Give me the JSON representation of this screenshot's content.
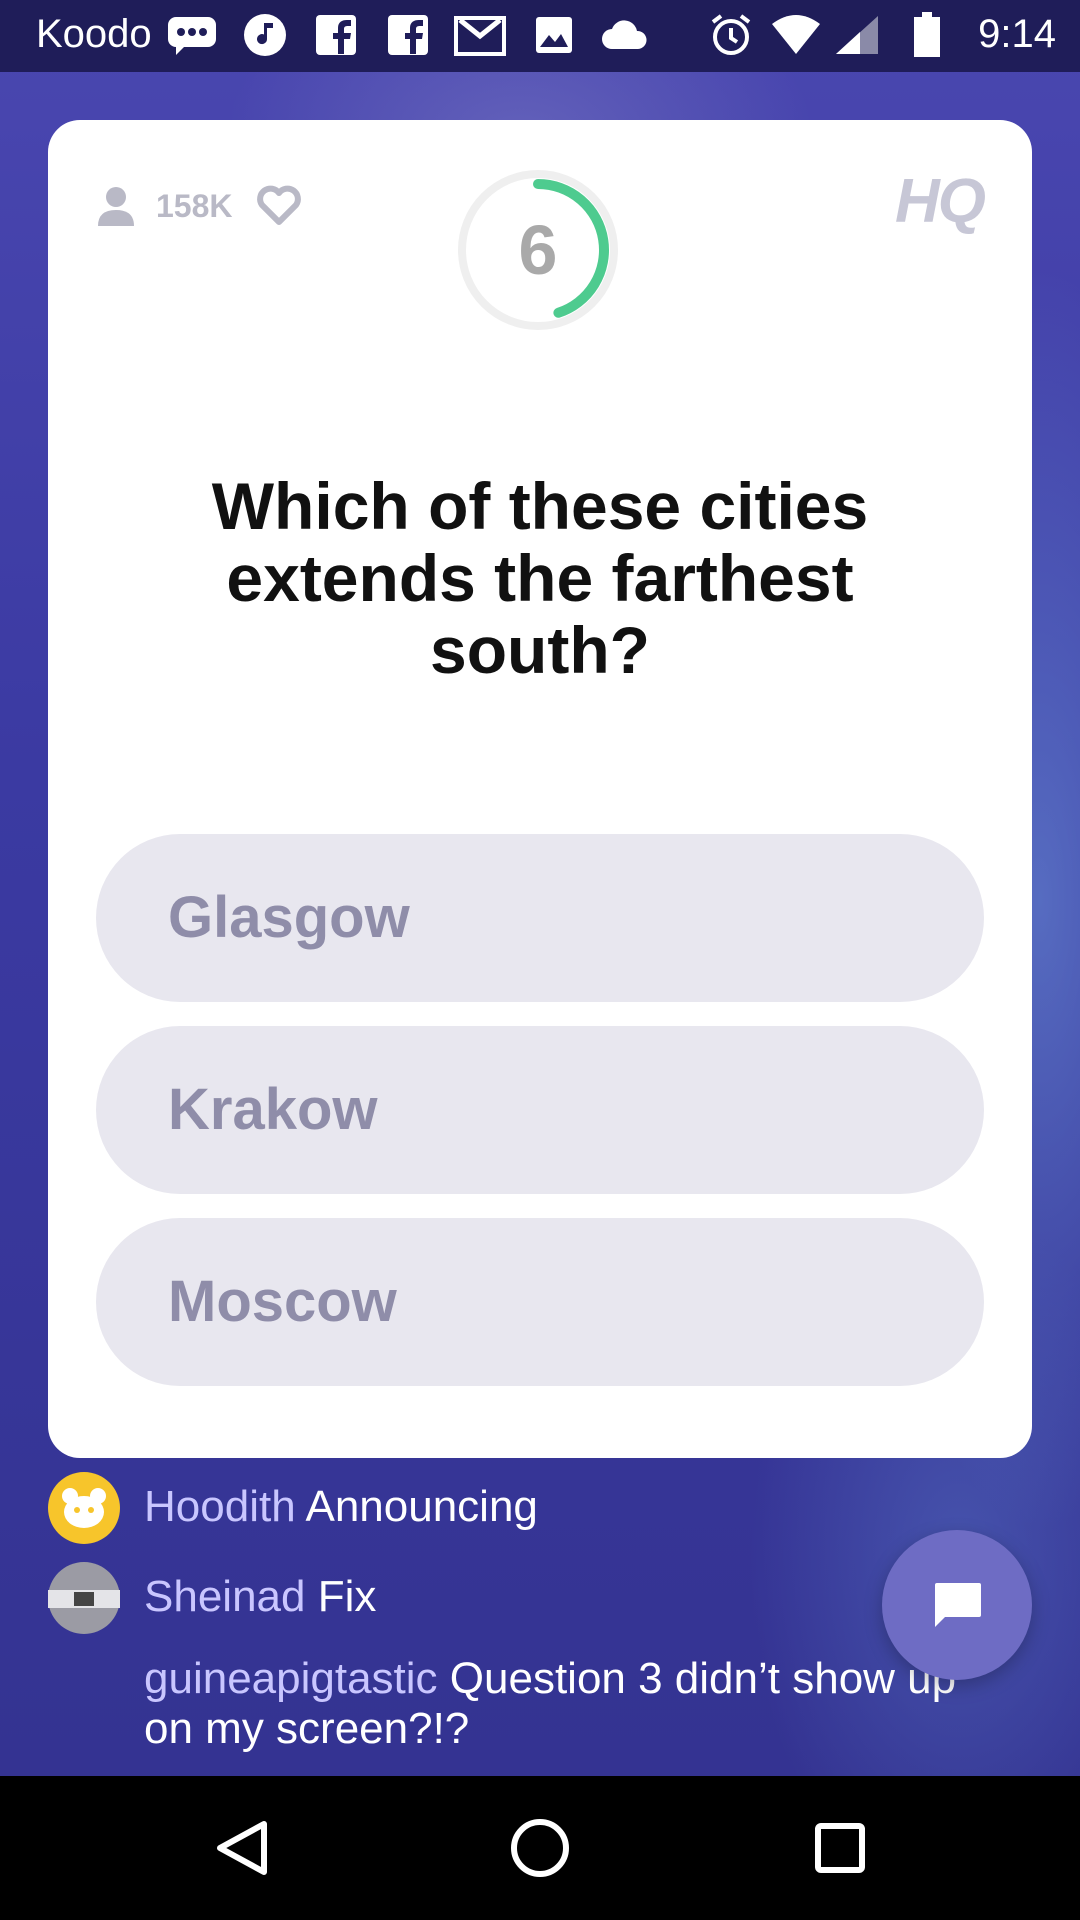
{
  "status_bar": {
    "carrier": "Koodo",
    "time": "9:14",
    "icons": [
      "chat-bubble-icon",
      "music-icon",
      "facebook-icon",
      "facebook-icon",
      "gmail-icon",
      "image-icon",
      "cloud-icon",
      "alarm-icon",
      "wifi-icon",
      "signal-icon",
      "battery-icon"
    ]
  },
  "header": {
    "viewer_count": "158K",
    "logo": "HQ",
    "timer_value": "6",
    "timer_progress": 0.45
  },
  "question": {
    "text": "Which of these cities extends the farthest south?"
  },
  "answers": [
    {
      "label": "Glasgow"
    },
    {
      "label": "Krakow"
    },
    {
      "label": "Moscow"
    }
  ],
  "chat": [
    {
      "user": "Hoodith",
      "message": "Announcing"
    },
    {
      "user": "Sheinad",
      "message": "Fix"
    },
    {
      "user": "guineapigtastic",
      "message": "Question 3 didn’t show up on my screen?!?"
    }
  ],
  "colors": {
    "accent_green": "#4ecb8f",
    "background": "#3d3ba0",
    "answer_bg": "#e8e7ef"
  },
  "nav": {
    "buttons": [
      "back-icon",
      "home-icon",
      "recents-icon"
    ]
  }
}
